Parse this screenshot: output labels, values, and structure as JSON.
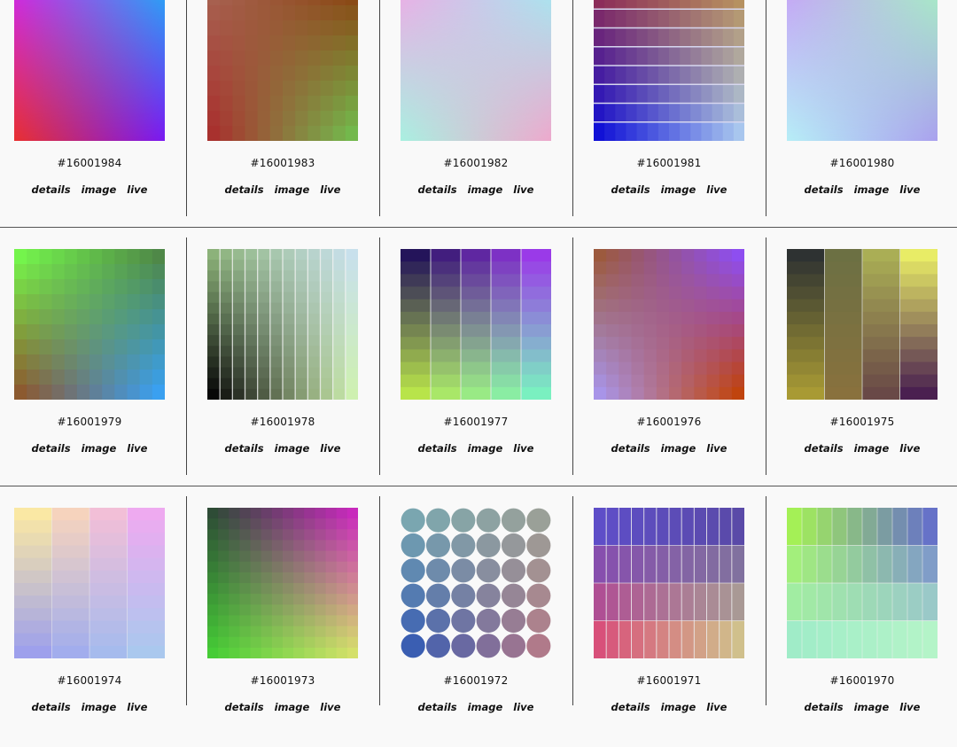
{
  "link_labels": {
    "details": "details",
    "image": "image",
    "live": "live"
  },
  "items": [
    {
      "id": "#16001984",
      "art": {
        "kind": "smooth",
        "corners": [
          "#cf2ae6",
          "#29a6f6",
          "#e8302f",
          "#7a18f2"
        ]
      }
    },
    {
      "id": "#16001983",
      "art": {
        "kind": "grid",
        "cols": 12,
        "rows": 10,
        "corners": [
          "#a7604f",
          "#8a4a16",
          "#a8312e",
          "#73b84c"
        ]
      }
    },
    {
      "id": "#16001982",
      "art": {
        "kind": "smooth",
        "corners": [
          "#ecaee6",
          "#a8e6f0",
          "#a8f0e0",
          "#eea8cc"
        ]
      }
    },
    {
      "id": "#16001981",
      "art": {
        "kind": "hbands",
        "rows": 8,
        "corners": [
          "#8c2d5a",
          "#b69160",
          "#1111d6",
          "#a8c6ee"
        ],
        "line": "#d6d6ee"
      }
    },
    {
      "id": "#16001980",
      "art": {
        "kind": "smooth",
        "corners": [
          "#c6a6f6",
          "#a8ecc6",
          "#b6eef6",
          "#aaa0ee"
        ]
      }
    },
    {
      "id": "#16001979",
      "art": {
        "kind": "grid",
        "cols": 12,
        "rows": 10,
        "corners": [
          "#74f44c",
          "#4f8848",
          "#8c5a30",
          "#3aa0f0"
        ]
      }
    },
    {
      "id": "#16001978",
      "art": {
        "kind": "vstripes",
        "cols": 12,
        "corners": [
          "#8cb27a",
          "#c8e0ec",
          "#080808",
          "#cef0b0"
        ],
        "line": "#f3f3f3"
      }
    },
    {
      "id": "#16001977",
      "art": {
        "kind": "cells",
        "cols": 5,
        "rows": 12,
        "corners": [
          "#24145a",
          "#9a3ae8",
          "#b8e44a",
          "#7af0c0"
        ],
        "line": "#e8e8ee"
      }
    },
    {
      "id": "#16001976",
      "art": {
        "kind": "grid",
        "cols": 12,
        "rows": 12,
        "corners": [
          "#9c5a3e",
          "#8e4ef0",
          "#a894e8",
          "#c0440e"
        ]
      }
    },
    {
      "id": "#16001975",
      "art": {
        "kind": "cells",
        "cols": 4,
        "rows": 12,
        "corners": [
          "#2e3232",
          "#e8ec66",
          "#a89a34",
          "#4a2050"
        ],
        "line": "#d0d0c6"
      }
    },
    {
      "id": "#16001974",
      "art": {
        "kind": "cells",
        "cols": 4,
        "rows": 12,
        "corners": [
          "#fae8a4",
          "#eeaaf0",
          "#9ea0ec",
          "#aac8ee"
        ],
        "line": "#eeeeee",
        "soft": true
      }
    },
    {
      "id": "#16001973",
      "art": {
        "kind": "grid",
        "cols": 14,
        "rows": 14,
        "corners": [
          "#2e4c36",
          "#c82abc",
          "#46cc36",
          "#d4e06a"
        ]
      }
    },
    {
      "id": "#16001972",
      "art": {
        "kind": "circles",
        "cols": 6,
        "rows": 6,
        "corners": [
          "#7aa6b0",
          "#9aa098",
          "#3a5eb2",
          "#b07a8a"
        ]
      }
    },
    {
      "id": "#16001971",
      "art": {
        "kind": "cells",
        "cols": 12,
        "rows": 4,
        "corners": [
          "#5e4ec8",
          "#5a4aa8",
          "#d8507a",
          "#d0c08c"
        ],
        "line": "#eeeeee"
      }
    },
    {
      "id": "#16001970",
      "art": {
        "kind": "cells",
        "cols": 10,
        "rows": 4,
        "corners": [
          "#a4f056",
          "#6672c8",
          "#a0ecc8",
          "#b4f4c8"
        ],
        "line": "#f0f0f0",
        "soft": true
      }
    }
  ]
}
